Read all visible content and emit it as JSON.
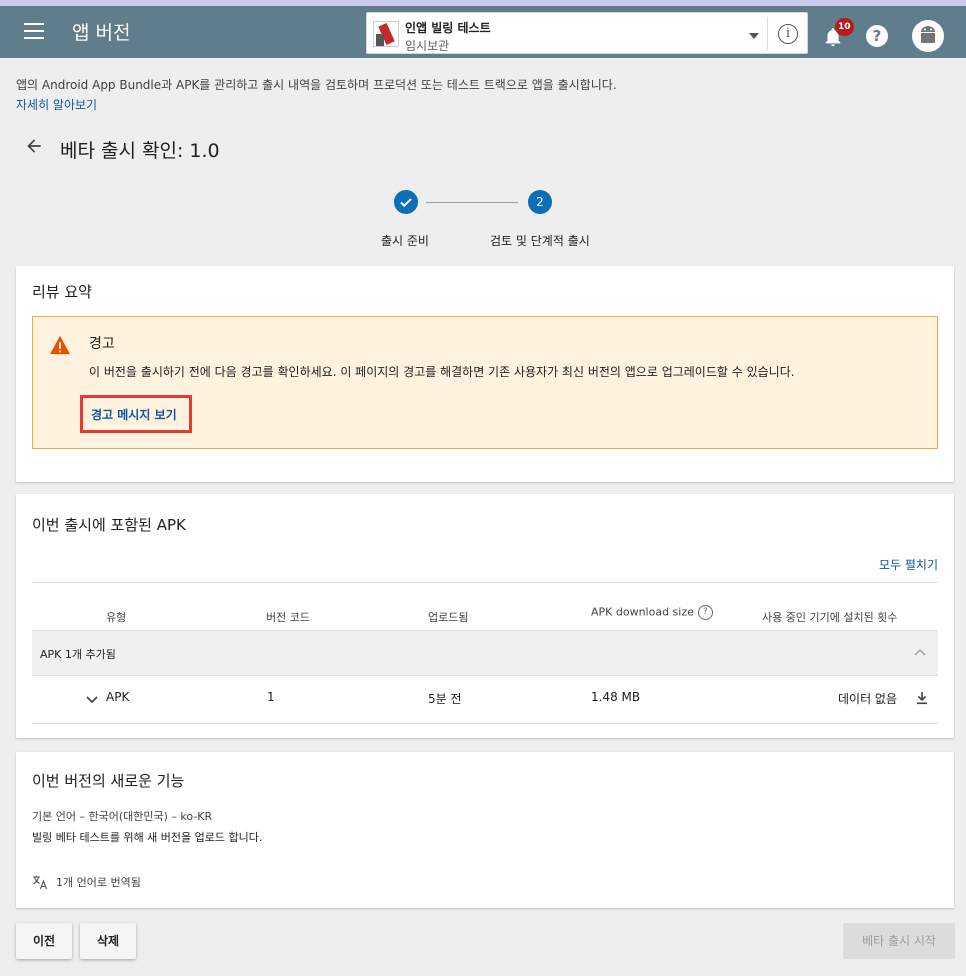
{
  "header": {
    "title": "앱 버전",
    "app_name": "인앱 빌링 테스트",
    "app_status": "임시보관",
    "notification_count": "10",
    "help_glyph": "?",
    "info_glyph": "i",
    "colors": {
      "header_bg": "#607d8b",
      "accent": "#0b6fb8",
      "badge": "#b71c1c"
    }
  },
  "intro": {
    "description": "앱의 Android App Bundle과 APK를 관리하고 출시 내역을 검토하며 프로덕션 또는 테스트 트랙으로 앱을 출시합니다.",
    "learn_more": "자세히 알아보기"
  },
  "page": {
    "title": "베타 출시 확인: 1.0"
  },
  "stepper": {
    "steps": [
      {
        "label": "출시 준비",
        "state": "done",
        "glyph": ""
      },
      {
        "label": "검토 및 단계적 출시",
        "state": "current",
        "glyph": "2"
      }
    ]
  },
  "review": {
    "title": "리뷰 요약",
    "warning": {
      "title": "경고",
      "text": "이 버전을 출시하기 전에 다음 경고를 확인하세요. 이 페이지의 경고를 해결하면 기존 사용자가 최신 버전의 앱으로 업그레이드할 수 있습니다.",
      "link": "경고 메시지 보기"
    }
  },
  "apks": {
    "title": "이번 출시에 포함된 APK",
    "expand_all": "모두 펼치기",
    "columns": [
      "유형",
      "버전 코드",
      "업로드됨",
      "APK download size",
      "사용 중인 기기에 설치된 횟수"
    ],
    "help_glyph": "?",
    "group_label": "APK 1개 추가됨",
    "row": {
      "type": "APK",
      "version_code": "1",
      "uploaded": "5분 전",
      "size": "1.48 MB",
      "installs": "데이터 없음"
    }
  },
  "features": {
    "title": "이번 버전의 새로운 기능",
    "language": "기본 언어 – 한국어(대한민국) – ko-KR",
    "text": "빌링 베타 테스트를 위해 새 버전을 업로드 합니다.",
    "translated": "1개 언어로 번역됨"
  },
  "footer": {
    "prev_label": "이전",
    "delete_label": "삭제",
    "start_label": "베타 출시 시작"
  },
  "icons": [
    "menu-icon",
    "info-icon",
    "bell-icon",
    "help-icon",
    "avatar-icon",
    "back-arrow-icon",
    "check-icon",
    "warning-icon",
    "chevron-up-icon",
    "chevron-down-icon",
    "download-icon",
    "translate-icon"
  ]
}
